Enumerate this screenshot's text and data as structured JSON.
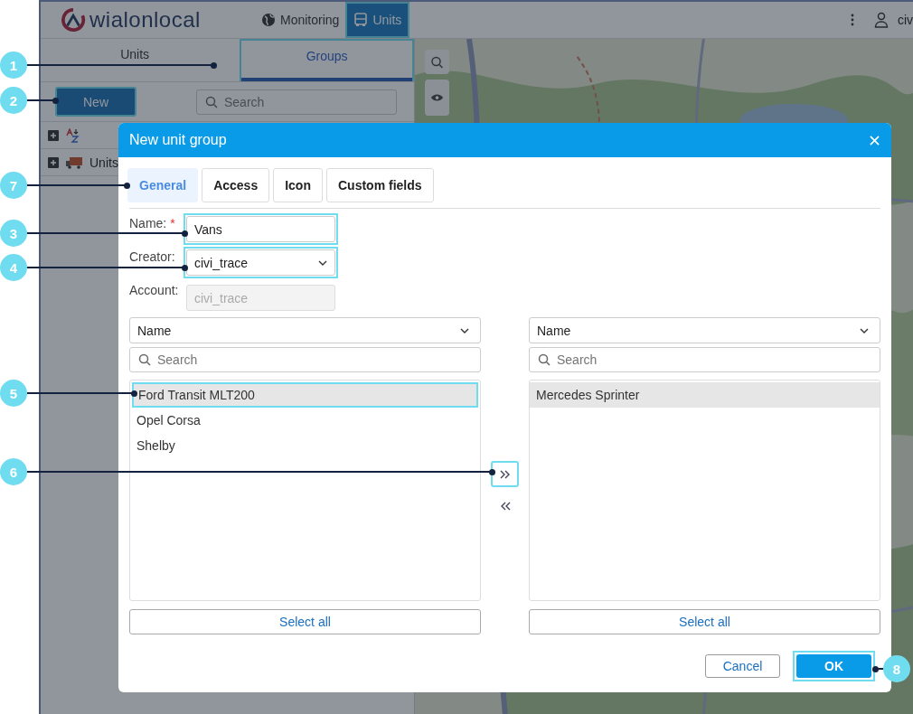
{
  "header": {
    "logo": "wialonlocal",
    "nav": [
      {
        "label": "Monitoring",
        "selected": false
      },
      {
        "label": "Units",
        "selected": true
      }
    ],
    "user": "civ"
  },
  "side_panel": {
    "tabs": [
      {
        "label": "Units",
        "selected": false
      },
      {
        "label": "Groups",
        "selected": true
      }
    ],
    "new_button": "New",
    "search": {
      "placeholder": "Search"
    },
    "tree": [
      {
        "label": "Units",
        "expanded": false
      }
    ]
  },
  "dialog": {
    "title": "New unit group",
    "tabs": [
      {
        "label": "General",
        "selected": true
      },
      {
        "label": "Access",
        "selected": false
      },
      {
        "label": "Icon",
        "selected": false
      },
      {
        "label": "Custom fields",
        "selected": false
      }
    ],
    "fields": [
      {
        "kind": "text",
        "label": "Name:",
        "required_mark": "*",
        "value": "Vans"
      },
      {
        "kind": "select",
        "label": "Creator:",
        "value": "civi_trace"
      },
      {
        "kind": "disabled",
        "label": "Account:",
        "value": "civi_trace"
      }
    ],
    "lists": [
      {
        "sort": "Name",
        "search": {
          "placeholder": "Search"
        },
        "items": [
          {
            "label": "Ford Transit MLT200",
            "selected": true
          },
          {
            "label": "Opel Corsa",
            "selected": false
          },
          {
            "label": "Shelby",
            "selected": false
          }
        ],
        "select_all": "Select all"
      },
      {
        "sort": "Name",
        "search": {
          "placeholder": "Search"
        },
        "items": [
          {
            "label": "Mercedes Sprinter",
            "selected": true
          }
        ],
        "select_all": "Select all"
      }
    ],
    "buttons": [
      {
        "kind": "secondary",
        "label": "Cancel"
      },
      {
        "kind": "primary",
        "label": "OK"
      }
    ]
  },
  "callouts": [
    "1",
    "2",
    "7",
    "3",
    "4",
    "5",
    "6",
    "8"
  ]
}
